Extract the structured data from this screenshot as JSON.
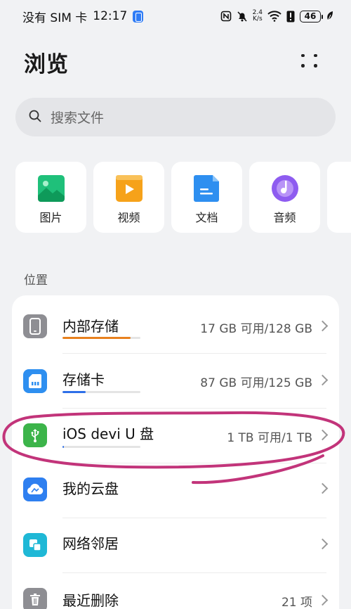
{
  "status_bar": {
    "carrier": "没有 SIM 卡",
    "time": "12:17",
    "net_speed_value": "2.4",
    "net_speed_unit": "K/s",
    "battery": "46"
  },
  "header": {
    "title": "浏览"
  },
  "search": {
    "placeholder": "搜索文件"
  },
  "categories": [
    {
      "label": "图片",
      "icon": "image-icon",
      "color": "#1fc07a"
    },
    {
      "label": "视频",
      "icon": "video-icon",
      "color": "#f6a21a"
    },
    {
      "label": "文档",
      "icon": "document-icon",
      "color": "#2e8ff0"
    },
    {
      "label": "音频",
      "icon": "audio-icon",
      "color": "#8e5cf0"
    }
  ],
  "locations": {
    "section_label": "位置",
    "items": [
      {
        "label": "内部存储",
        "meta": "17 GB 可用/128 GB",
        "icon": "phone-icon",
        "icon_color": "#8e8e93",
        "usage": 0.87,
        "usage_color": "#e8811e"
      },
      {
        "label": "存储卡",
        "meta": "87 GB 可用/125 GB",
        "icon": "sd-card-icon",
        "icon_color": "#2e8ff0",
        "usage": 0.3,
        "usage_color": "#2e6fe8"
      },
      {
        "label": "iOS devi U 盘",
        "meta": "1 TB 可用/1 TB",
        "icon": "usb-icon",
        "icon_color": "#3cb44a",
        "usage": 0.02,
        "usage_color": "#2e6fe8"
      },
      {
        "label": "我的云盘",
        "meta": "",
        "icon": "cloud-icon",
        "icon_color": "#2e7ff0"
      },
      {
        "label": "网络邻居",
        "meta": "",
        "icon": "network-icon",
        "icon_color": "#1fb8d6"
      },
      {
        "label": "最近删除",
        "meta": "21 项",
        "icon": "trash-icon",
        "icon_color": "#8e8e93"
      }
    ]
  },
  "colors": {
    "background": "#f1f2f4",
    "annotation": "#c2347a"
  }
}
